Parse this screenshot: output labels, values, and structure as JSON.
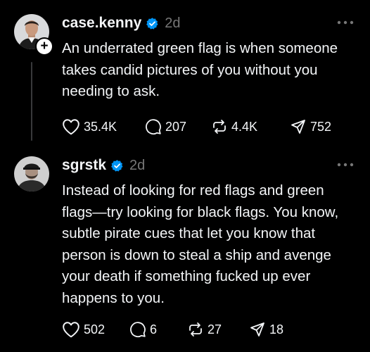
{
  "colors": {
    "background": "#000000",
    "text": "#f3f5f7",
    "muted": "#777777",
    "verified": "#0095f6",
    "thread_line": "#38393b"
  },
  "posts": [
    {
      "username": "case.kenny",
      "verified": true,
      "timestamp": "2d",
      "more_icon": "more-horizontal-icon",
      "follow_badge": "+",
      "text": "An underrated green flag is when someone takes candid pictures of you without you needing to ask.",
      "likes": "35.4K",
      "replies": "207",
      "reposts": "4.4K",
      "shares": "752"
    },
    {
      "username": "sgrstk",
      "verified": true,
      "timestamp": "2d",
      "more_icon": "more-horizontal-icon",
      "text": "Instead of looking for red flags and green flags—try looking for black flags. You know, subtle pirate cues that let you know that person is down to steal a ship and avenge your death if something fucked up ever happens to you.",
      "likes": "502",
      "replies": "6",
      "reposts": "27",
      "shares": "18"
    }
  ]
}
